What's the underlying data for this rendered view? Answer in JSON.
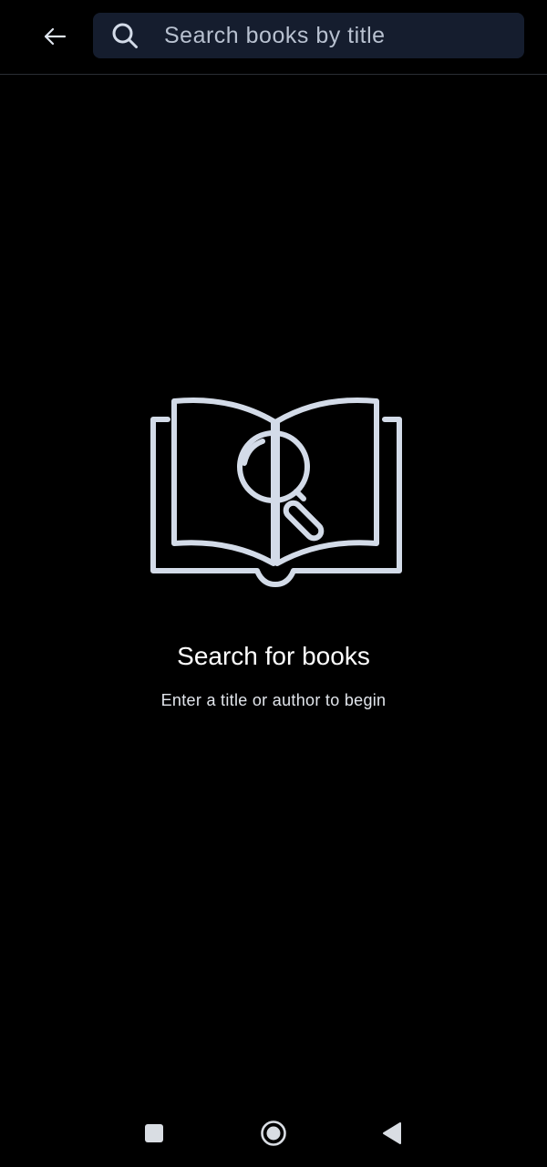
{
  "header": {
    "back_icon": "arrow-left-icon",
    "search": {
      "icon": "search-icon",
      "value": "",
      "placeholder": "Search books by title"
    }
  },
  "empty_state": {
    "illustration_icon": "open-book-search-icon",
    "title": "Search for books",
    "subtitle": "Enter a title or author to begin"
  },
  "system_nav": {
    "items": [
      {
        "name": "recents",
        "icon": "square-icon"
      },
      {
        "name": "home",
        "icon": "circle-icon"
      },
      {
        "name": "back",
        "icon": "triangle-back-icon"
      }
    ]
  },
  "colors": {
    "background": "#000000",
    "search_field_bg": "#151d2e",
    "icon_color": "#d3dbe8",
    "divider": "#2a2d33"
  }
}
